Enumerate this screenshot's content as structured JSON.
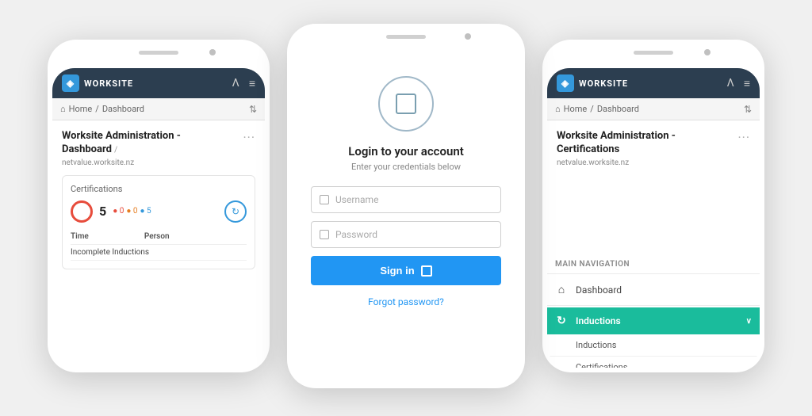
{
  "phones": {
    "left": {
      "header": {
        "logo_text": "WORKSITE",
        "icon1": "Λ",
        "icon2": "≡"
      },
      "breadcrumb": {
        "home": "Home",
        "separator": "/",
        "current": "Dashboard"
      },
      "page_title": "Worksite Administration -",
      "page_title2": "Dashboard",
      "page_domain": "netvalue.worksite.nz",
      "dots": "···",
      "card": {
        "title": "Certifications",
        "number": "5",
        "dot1": "0",
        "dot2": "0",
        "dot3": "5"
      },
      "table": {
        "col1": "Time",
        "col2": "Person",
        "row1": "Incomplete Inductions"
      }
    },
    "center": {
      "header_icon": "□",
      "title": "Login to your account",
      "subtitle": "Enter your credentials below",
      "username_placeholder": "Username",
      "password_placeholder": "Password",
      "signin_label": "Sign in",
      "forgot_label": "Forgot password?"
    },
    "right": {
      "header": {
        "logo_text": "WORKSITE",
        "icon1": "Λ",
        "icon2": "≡"
      },
      "breadcrumb": {
        "home": "Home",
        "separator": "/",
        "current": "Dashboard"
      },
      "page_title": "Worksite Administration -",
      "page_title2": "Certifications",
      "page_domain": "netvalue.worksite.nz",
      "dots": "···",
      "nav": {
        "section_title": "Main navigation",
        "item1": "Dashboard",
        "item2": "Inductions",
        "sub1": "Inductions",
        "sub2": "Certifications"
      }
    }
  }
}
